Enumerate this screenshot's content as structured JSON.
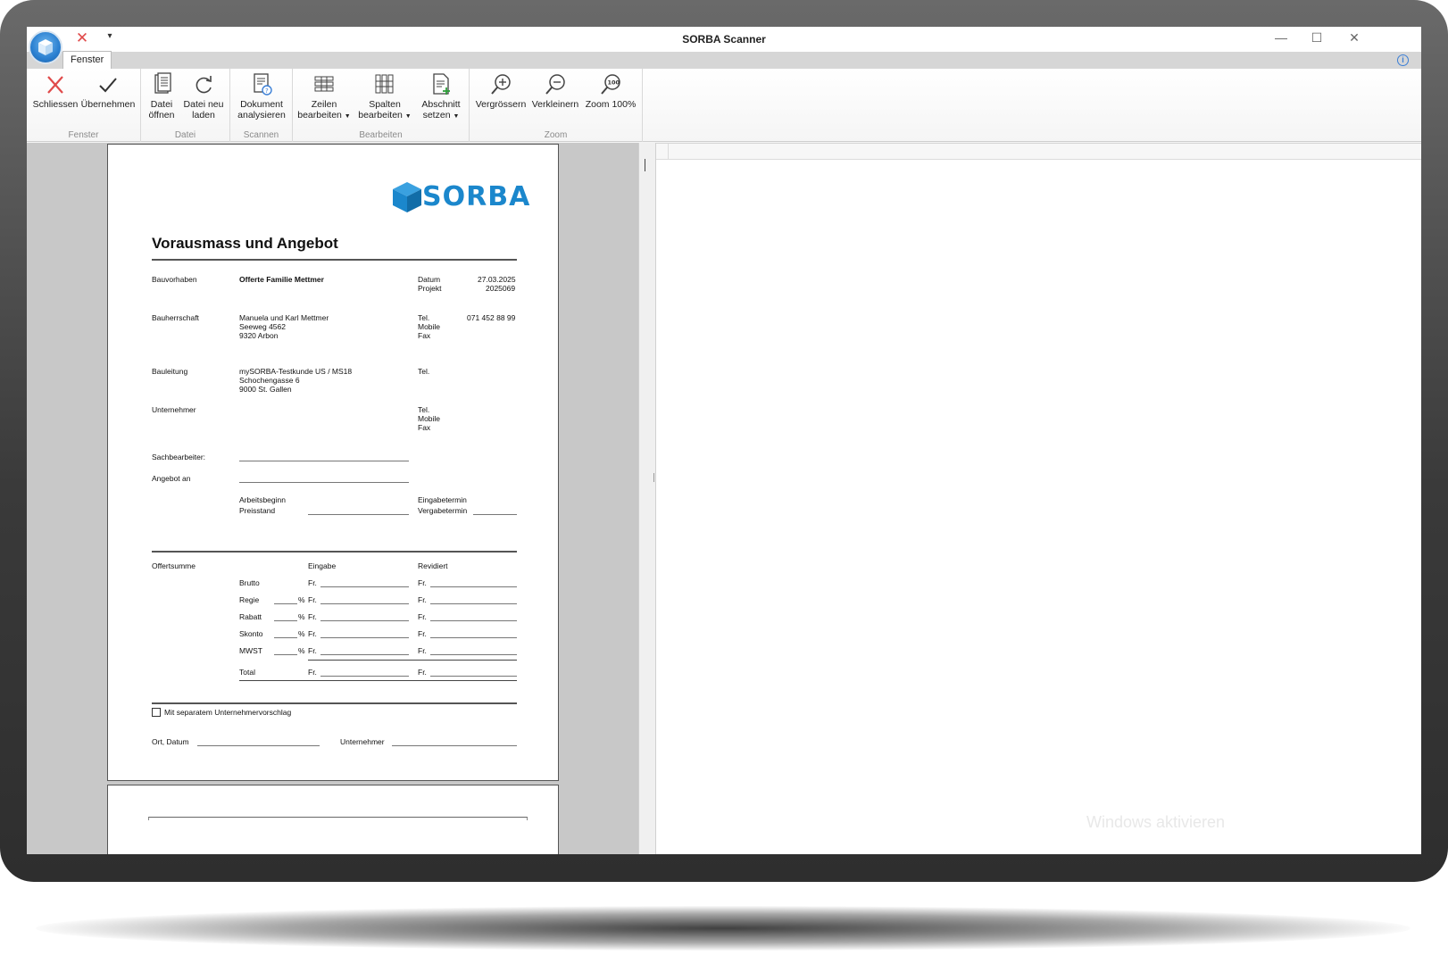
{
  "window": {
    "title": "SORBA Scanner",
    "qat_more": "▾",
    "minimize": "—",
    "maximize": "☐",
    "close": "✕"
  },
  "tabs": [
    {
      "label": "Fenster",
      "active": true
    }
  ],
  "ribbon": {
    "groups": [
      {
        "label": "Fenster",
        "buttons": [
          {
            "label": "Schliessen",
            "icon": "close-x-icon"
          },
          {
            "label": "Übernehmen",
            "icon": "checkmark-icon"
          }
        ]
      },
      {
        "label": "Datei",
        "buttons": [
          {
            "label1": "Datei",
            "label2": "öffnen",
            "icon": "document-icon"
          },
          {
            "label1": "Datei neu",
            "label2": "laden",
            "icon": "reload-icon"
          }
        ]
      },
      {
        "label": "Scannen",
        "buttons": [
          {
            "label1": "Dokument",
            "label2": "analysieren",
            "icon": "analyze-document-icon"
          }
        ]
      },
      {
        "label": "Bearbeiten",
        "buttons": [
          {
            "label1": "Zeilen",
            "label2": "bearbeiten",
            "icon": "rows-icon"
          },
          {
            "label1": "Spalten",
            "label2": "bearbeiten",
            "icon": "columns-icon"
          },
          {
            "label1": "Abschnitt",
            "label2": "setzen",
            "icon": "add-section-icon"
          }
        ]
      },
      {
        "label": "Zoom",
        "buttons": [
          {
            "label": "Vergrössern",
            "icon": "zoom-in-icon"
          },
          {
            "label": "Verkleinern",
            "icon": "zoom-out-icon"
          },
          {
            "label": "Zoom 100%",
            "icon": "zoom-100-icon",
            "badge": "100"
          }
        ]
      }
    ]
  },
  "document": {
    "logo": "SORBA",
    "title": "Vorausmass und Angebot",
    "bauvorhaben_label": "Bauvorhaben",
    "bauvorhaben_value": "Offerte Familie Mettmer",
    "datum_label": "Datum",
    "datum_value": "27.03.2025",
    "projekt_label": "Projekt",
    "projekt_value": "2025069",
    "bauherrschaft_label": "Bauherrschaft",
    "bauherrschaft_lines": [
      "Manuela und Karl Mettmer",
      "Seeweg 4562",
      "9320 Arbon"
    ],
    "bauherrschaft_tel_labels": [
      "Tel.",
      "Mobile",
      "Fax"
    ],
    "bauherrschaft_tel_value": "071 452 88 99",
    "bauleitung_label": "Bauleitung",
    "bauleitung_lines": [
      "mySORBA-Testkunde US / MS18",
      "Schochengasse 6",
      "9000 St. Gallen"
    ],
    "bauleitung_tel_label": "Tel.",
    "unternehmer_label": "Unternehmer",
    "unternehmer_tel_labels": [
      "Tel.",
      "Mobile",
      "Fax"
    ],
    "sachbearbeiter_label": "Sachbearbeiter:",
    "angebot_label": "Angebot an",
    "arbeitsbeginn_label": "Arbeitsbeginn",
    "preisstand_label": "Preisstand",
    "eingabetermin_label": "Eingabetermin",
    "vergabetermin_label": "Vergabetermin",
    "offertsumme_label": "Offertsumme",
    "eingabe_label": "Eingabe",
    "revidiert_label": "Revidiert",
    "summary_rows": [
      {
        "label": "Brutto",
        "percent": false
      },
      {
        "label": "Regie",
        "percent": true
      },
      {
        "label": "Rabatt",
        "percent": true
      },
      {
        "label": "Skonto",
        "percent": true
      },
      {
        "label": "MWST",
        "percent": true
      },
      {
        "label": "Total",
        "percent": false
      }
    ],
    "currency": "Fr.",
    "percent_sign": "%",
    "checkbox_label": "Mit separatem Unternehmervorschlag",
    "ort_datum_label": "Ort, Datum",
    "unternehmer_sign_label": "Unternehmer"
  },
  "watermark": "Windows aktivieren",
  "colors": {
    "accent": "#1b87cc",
    "close_red": "#e04a4a"
  }
}
